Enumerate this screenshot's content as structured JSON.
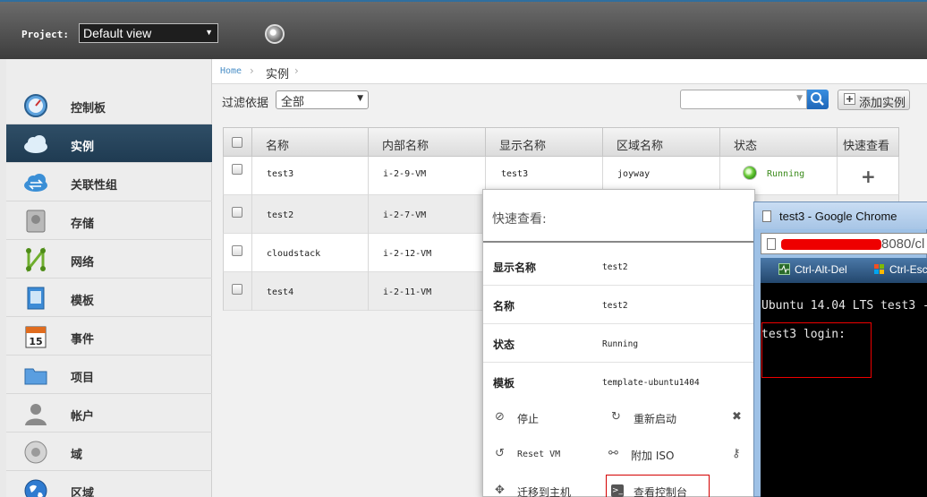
{
  "header": {
    "project_label": "Project:",
    "project_value": "Default view"
  },
  "sidebar": {
    "items": [
      {
        "label": "控制板",
        "icon": "dashboard-icon"
      },
      {
        "label": "实例",
        "icon": "cloud-icon",
        "active": true
      },
      {
        "label": "关联性组",
        "icon": "affinity-cloud-icon"
      },
      {
        "label": "存储",
        "icon": "storage-icon"
      },
      {
        "label": "网络",
        "icon": "network-icon"
      },
      {
        "label": "模板",
        "icon": "template-icon"
      },
      {
        "label": "事件",
        "icon": "calendar-icon"
      },
      {
        "label": "项目",
        "icon": "folder-icon"
      },
      {
        "label": "帐户",
        "icon": "user-icon"
      },
      {
        "label": "域",
        "icon": "domain-icon"
      },
      {
        "label": "区域",
        "icon": "globe-icon"
      }
    ]
  },
  "breadcrumb": {
    "home": "Home",
    "current": "实例"
  },
  "toolbar": {
    "filter_label": "过滤依据",
    "filter_value": "全部",
    "search_value": "",
    "add_label": "添加实例"
  },
  "table": {
    "columns": [
      "名称",
      "内部名称",
      "显示名称",
      "区域名称",
      "状态",
      "快速查看"
    ],
    "rows": [
      {
        "name": "test3",
        "internal": "i-2-9-VM",
        "display": "test3",
        "zone": "joyway",
        "state": "Running"
      },
      {
        "name": "test2",
        "internal": "i-2-7-VM"
      },
      {
        "name": "cloudstack",
        "internal": "i-2-12-VM"
      },
      {
        "name": "test4",
        "internal": "i-2-11-VM"
      }
    ]
  },
  "quickview": {
    "title": "快速查看:",
    "fields": [
      {
        "key": "显示名称",
        "value": "test2"
      },
      {
        "key": "名称",
        "value": "test2"
      },
      {
        "key": "状态",
        "value": "Running"
      },
      {
        "key": "模板",
        "value": "template-ubuntu1404"
      }
    ],
    "actions": {
      "stop": "停止",
      "reboot": "重新启动",
      "reset": "Reset VM",
      "attach": "附加 ISO",
      "migrate": "迁移到主机",
      "console": "查看控制台"
    }
  },
  "chrome_window": {
    "title": "test3 - Google Chrome",
    "url_visible": "8080/cl",
    "tool_ctrl_alt_del": "Ctrl-Alt-Del",
    "tool_ctrl_esc": "Ctrl-Esc",
    "console_line1": "Ubuntu 14.04 LTS test3 -",
    "console_line2": "test3 login:"
  },
  "colors": {
    "accent": "#2f4e66",
    "link": "#4a8fc7",
    "running": "#3a8a1a",
    "annotation": "#ee0000"
  }
}
